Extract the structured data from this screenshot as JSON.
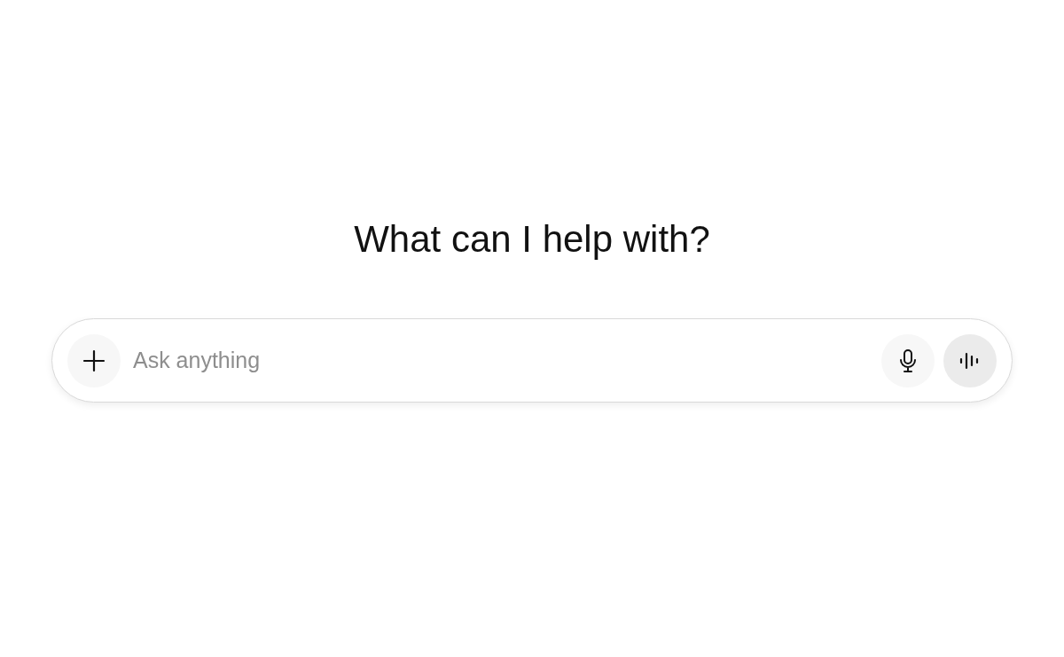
{
  "heading": "What can I help with?",
  "composer": {
    "placeholder": "Ask anything"
  }
}
